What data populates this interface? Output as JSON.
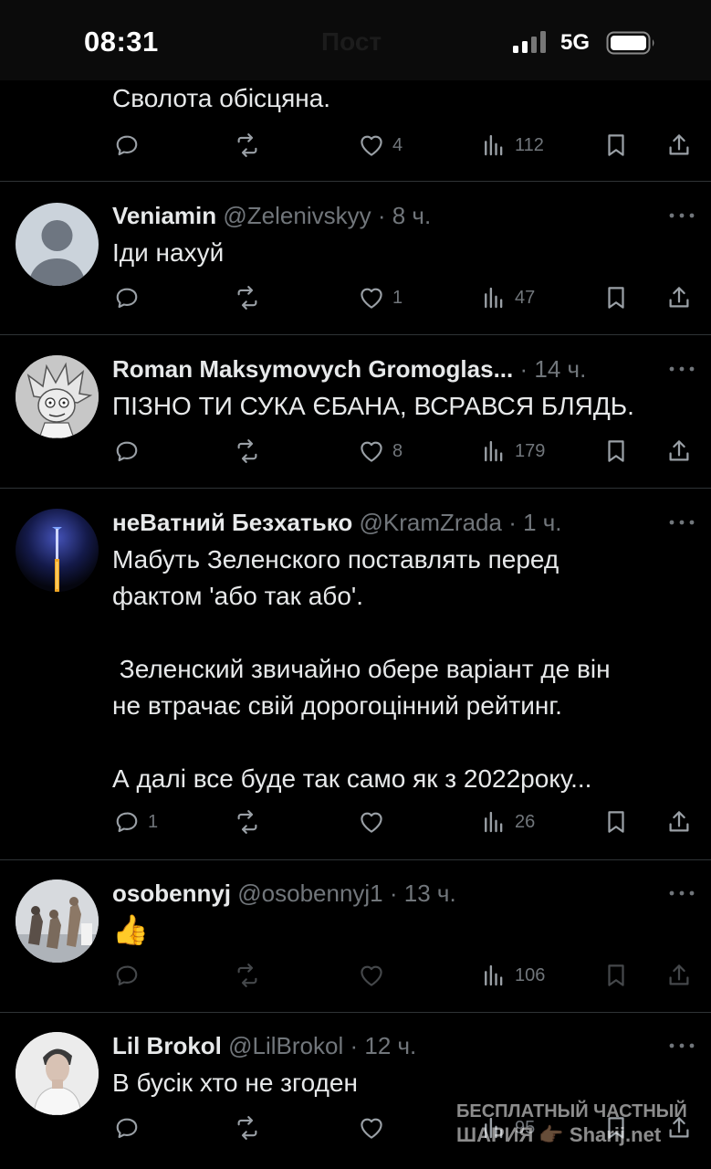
{
  "status_bar": {
    "time": "08:31",
    "ghost_title": "Пост",
    "network": "5G"
  },
  "colors": {
    "background": "#000000",
    "text": "#e7e9ea",
    "secondary": "#71767b",
    "divider": "#2f3336"
  },
  "partial_tweet": {
    "text": "Сволота обісцяна.",
    "actions": {
      "replies": "",
      "reposts": "",
      "likes": "4",
      "views": "112"
    }
  },
  "tweets": [
    {
      "name": "Veniamin",
      "handle": "@Zelenivskyy",
      "time": "8 ч.",
      "text": "Іди нахуй",
      "actions": {
        "replies": "",
        "reposts": "",
        "likes": "1",
        "views": "47"
      }
    },
    {
      "name": "Roman Maksymovych Gromoglas...",
      "handle": "",
      "time": "14 ч.",
      "text": "ПІЗНО ТИ СУКА ЄБАНА, ВСРАВСЯ БЛЯДЬ.",
      "actions": {
        "replies": "",
        "reposts": "",
        "likes": "8",
        "views": "179"
      }
    },
    {
      "name": "неВатний Безхатько",
      "handle": "@KramZrada",
      "time": "1 ч.",
      "text": "Мабуть Зеленского поставлять перед\nфактом 'або так або'.\n\n Зеленский звичайно обере варіант де він\nне втрачає свій дорогоцінний рейтинг.\n\nА далі все буде так само як з 2022року...",
      "actions": {
        "replies": "1",
        "reposts": "",
        "likes": "",
        "views": "26"
      }
    },
    {
      "name": "osobennyj",
      "handle": "@osobennyj1",
      "time": "13 ч.",
      "text": "👍",
      "actions": {
        "replies": "",
        "reposts": "",
        "likes": "",
        "views": "106"
      }
    },
    {
      "name": "Lil Brokol",
      "handle": "@LilBrokol",
      "time": "12 ч.",
      "text": "В бусік хто не згоден",
      "actions": {
        "replies": "",
        "reposts": "",
        "likes": "",
        "views": "95"
      }
    }
  ],
  "watermark": {
    "line1": "БЕСПЛАТНЫЙ ЧАСТНЫЙ",
    "line2": "ШАРИЯ 👉🏽 Sharij.net"
  }
}
